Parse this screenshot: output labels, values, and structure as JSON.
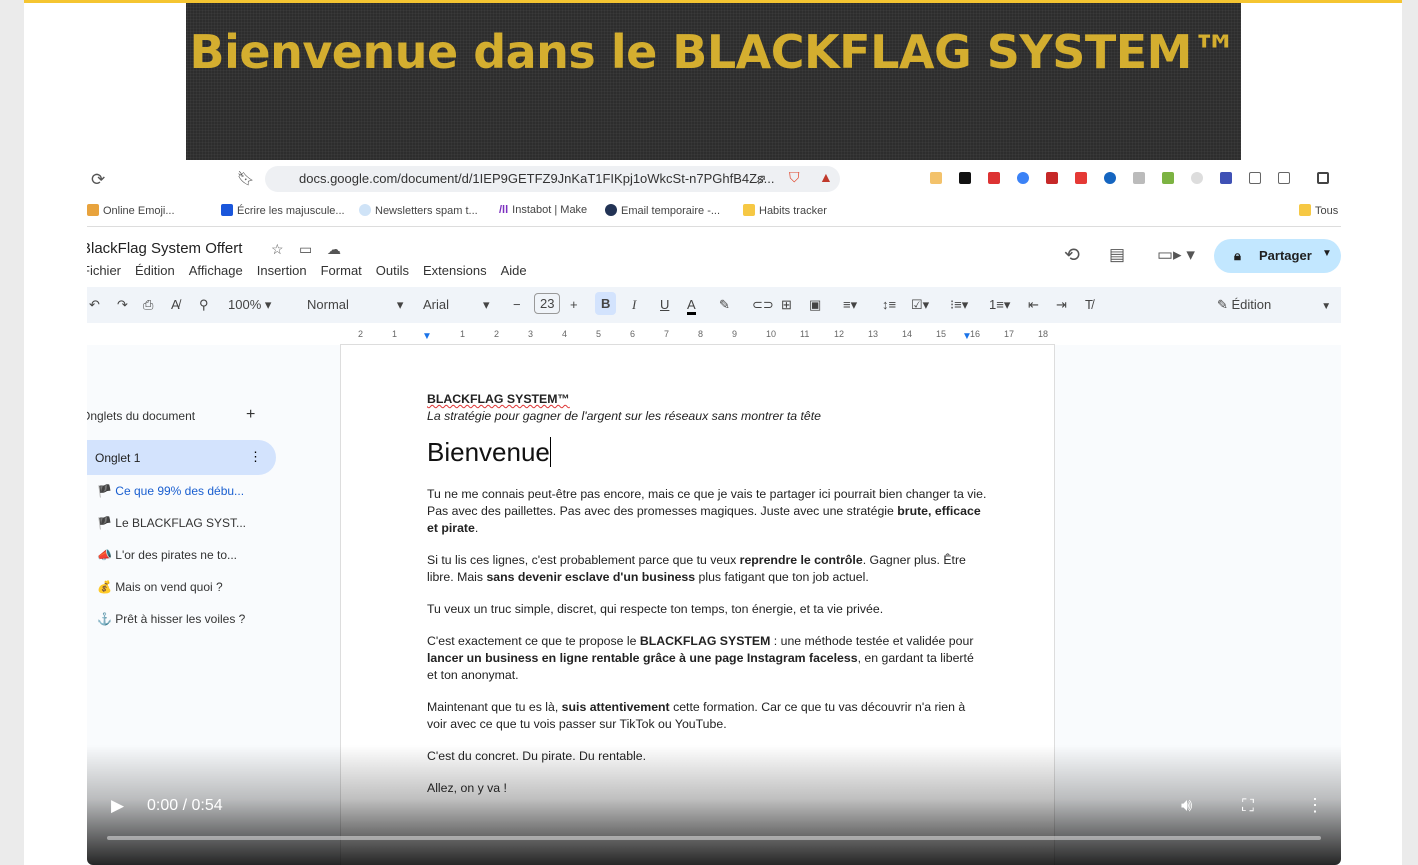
{
  "banner": {
    "title": "Bienvenue dans le BLACKFLAG SYSTEM™"
  },
  "browser": {
    "url": "docs.google.com/document/d/1IEP9GETFZ9JnKaT1FIKpj1oWkcSt-n7PGhfB4Zs...",
    "bookmarks": [
      "Online Emoji...",
      "Écrire les majuscule...",
      "Newsletters spam t...",
      "Instabot | Make",
      "Email temporaire -...",
      "Habits tracker",
      "Tous"
    ]
  },
  "docs": {
    "title": "BlackFlag System Offert",
    "menu": [
      "Fichier",
      "Édition",
      "Affichage",
      "Insertion",
      "Format",
      "Outils",
      "Extensions",
      "Aide"
    ],
    "share": "Partager",
    "zoom": "100%",
    "style": "Normal",
    "font": "Arial",
    "font_size": "23",
    "mode": "Édition",
    "ruler": [
      "2",
      "1",
      "1",
      "2",
      "3",
      "4",
      "5",
      "6",
      "7",
      "8",
      "9",
      "10",
      "11",
      "12",
      "13",
      "14",
      "15",
      "16",
      "17",
      "18"
    ]
  },
  "sidebar": {
    "title": "Onglets du document",
    "tab": "Onglet 1",
    "items": [
      {
        "icon": "🏴",
        "label": "Ce que 99% des débu..."
      },
      {
        "icon": "🏴",
        "label": "Le BLACKFLAG SYST..."
      },
      {
        "icon": "📣",
        "label": "L'or des pirates ne to..."
      },
      {
        "icon": "💰",
        "label": "Mais on vend quoi ?"
      },
      {
        "icon": "⚓",
        "label": "Prêt à hisser les voiles ?"
      }
    ]
  },
  "doc": {
    "brand": "BLACKFLAG SYSTEM™",
    "subtitle": "La stratégie pour gagner de l'argent sur les réseaux sans montrer ta tête",
    "heading": "Bienvenue",
    "p1a": "Tu ne me connais peut-être pas encore, mais ce que je vais te partager ici pourrait bien changer ta vie. Pas avec des paillettes. Pas avec des promesses magiques. Juste avec une stratégie ",
    "p1b": "brute, efficace et pirate",
    "p1c": ".",
    "p2a": "Si tu lis ces lignes, c'est probablement parce que tu veux ",
    "p2b": "reprendre le contrôle",
    "p2c": ". Gagner plus. Être libre. Mais ",
    "p2d": "sans devenir esclave d'un business",
    "p2e": " plus fatigant que ton job actuel.",
    "p3": "Tu veux un truc simple, discret, qui respecte ton temps, ton énergie, et ta vie privée.",
    "p4a": "C'est exactement ce que te propose le ",
    "p4b": "BLACKFLAG SYSTEM",
    "p4c": " : une méthode testée et validée pour ",
    "p4d": "lancer un business en ligne rentable grâce à une page Instagram faceless",
    "p4e": ", en gardant ta liberté et ton anonymat.",
    "p5a": "Maintenant que tu es là, ",
    "p5b": "suis attentivement",
    "p5c": " cette formation. Car ce que tu vas découvrir n'a rien à voir avec ce que tu vois passer sur TikTok ou YouTube.",
    "p6": "C'est du concret. Du pirate. Du rentable.",
    "p7": "Allez, on y va !"
  },
  "player": {
    "time": "0:00 / 0:54",
    "progress": 0
  }
}
